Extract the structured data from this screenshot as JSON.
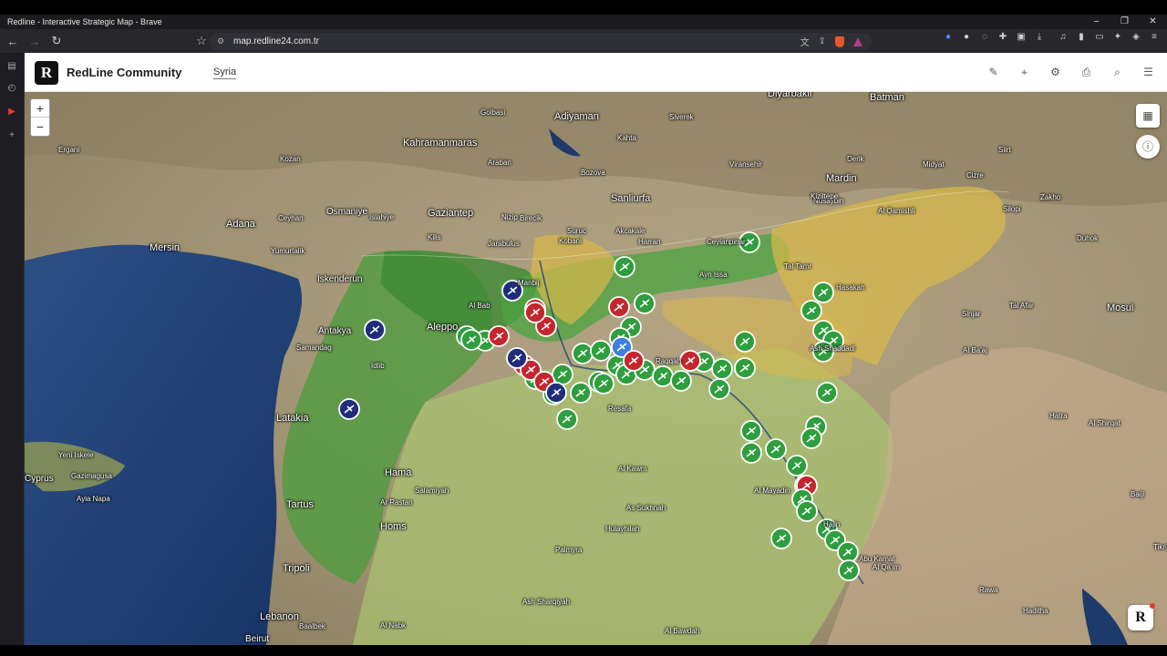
{
  "window": {
    "title": "Redline - Interactive Strategic Map - Brave",
    "min": "–",
    "max": "❐",
    "close": "✕"
  },
  "browser": {
    "url": "map.redline24.com.tr",
    "back": "←",
    "forward": "→",
    "reload": "↻",
    "bookmark": "☆",
    "site_info": "⚙",
    "translate": "文",
    "share": "⇪"
  },
  "app": {
    "name": "RedLine Community",
    "logo_letter": "R",
    "region_tab": "Syria",
    "header_icons": [
      "draw-icon",
      "location-pin-icon",
      "settings-icon",
      "camera-icon",
      "search-icon",
      "menu-icon"
    ]
  },
  "map": {
    "zoom_in": "+",
    "zoom_out": "−",
    "brand_letter": "R",
    "colors": {
      "sea": "#1f3d6e",
      "land": "#a59a7c",
      "green_zone": "#4e9b3f",
      "light_green_zone": "#a9c46f",
      "yellow_zone": "#d8b84a",
      "marker_green": "#2e9e3e",
      "marker_red": "#c4262e",
      "marker_navy": "#1f2d7a",
      "marker_blue": "#3d7ee0"
    },
    "labels": [
      {
        "text": "Diyarbakir"
      },
      {
        "text": "Batman"
      },
      {
        "text": "Adiyaman"
      },
      {
        "text": "Siverek"
      },
      {
        "text": "Kahramanmaras"
      },
      {
        "text": "Gaziantep"
      },
      {
        "text": "Sanliurfa"
      },
      {
        "text": "Mardin"
      },
      {
        "text": "Adana"
      },
      {
        "text": "Osmaniye"
      },
      {
        "text": "Mersin"
      },
      {
        "text": "Iskenderun"
      },
      {
        "text": "Aleppo"
      },
      {
        "text": "Antakya"
      },
      {
        "text": "Latakia"
      },
      {
        "text": "Hama"
      },
      {
        "text": "Homs"
      },
      {
        "text": "Tartus"
      },
      {
        "text": "Tripoli"
      },
      {
        "text": "Lebanon"
      },
      {
        "text": "Beirut"
      },
      {
        "text": "Palmyra"
      },
      {
        "text": "Mosul"
      },
      {
        "text": "Tal Afar"
      },
      {
        "text": "Duhok"
      },
      {
        "text": "Zakho"
      },
      {
        "text": "Al Qamishli"
      },
      {
        "text": "Hasakah"
      },
      {
        "text": "Raqqah"
      },
      {
        "text": "Resafa"
      },
      {
        "text": "Al Kawm"
      },
      {
        "text": "As Sukhnah"
      },
      {
        "text": "Al Mayadin"
      },
      {
        "text": "Salamiyah"
      },
      {
        "text": "Ar Rastan"
      },
      {
        "text": "Idlib"
      },
      {
        "text": "Derik"
      },
      {
        "text": "Ceylanpinar"
      },
      {
        "text": "Nusaybin"
      },
      {
        "text": "Akcakale"
      },
      {
        "text": "Birecik"
      },
      {
        "text": "Islahiye"
      },
      {
        "text": "Kilis"
      },
      {
        "text": "Ceyhan"
      },
      {
        "text": "Kozan"
      },
      {
        "text": "Yumurtalik"
      },
      {
        "text": "Samandag"
      },
      {
        "text": "Tal Tamr"
      },
      {
        "text": "Ash Shaddadi"
      },
      {
        "text": "Ayn Issa"
      },
      {
        "text": "Kobani"
      },
      {
        "text": "Manbij"
      },
      {
        "text": "Al Bab"
      },
      {
        "text": "Jarabulus"
      },
      {
        "text": "Silopi"
      },
      {
        "text": "Cizre"
      },
      {
        "text": "Ergani"
      },
      {
        "text": "Siirt"
      },
      {
        "text": "Rawa"
      },
      {
        "text": "Haditha"
      },
      {
        "text": "Al Qa'im"
      },
      {
        "text": "Baiji"
      },
      {
        "text": "Tikrit"
      },
      {
        "text": "Hatra"
      },
      {
        "text": "Al Shirqat"
      },
      {
        "text": "Al Ba'aj"
      },
      {
        "text": "Sinjar"
      },
      {
        "text": "Cyprus"
      },
      {
        "text": "Gazimagusa"
      },
      {
        "text": "Ayia Napa"
      },
      {
        "text": "Yeni Iskele"
      },
      {
        "text": "Baalbek"
      },
      {
        "text": "Al Nabk"
      },
      {
        "text": "Al Bawdah"
      },
      {
        "text": "Abu Kamal"
      },
      {
        "text": "Hajin"
      },
      {
        "text": "Hulayhilah"
      },
      {
        "text": "Ash Sharqiyah"
      },
      {
        "text": "Nizip"
      },
      {
        "text": "Suruc"
      },
      {
        "text": "Harran"
      },
      {
        "text": "Viransehir"
      },
      {
        "text": "Kiziltepe"
      },
      {
        "text": "Midyat"
      },
      {
        "text": "Bozova"
      },
      {
        "text": "Golbasi"
      },
      {
        "text": "Kahta"
      },
      {
        "text": "Araban"
      }
    ]
  }
}
